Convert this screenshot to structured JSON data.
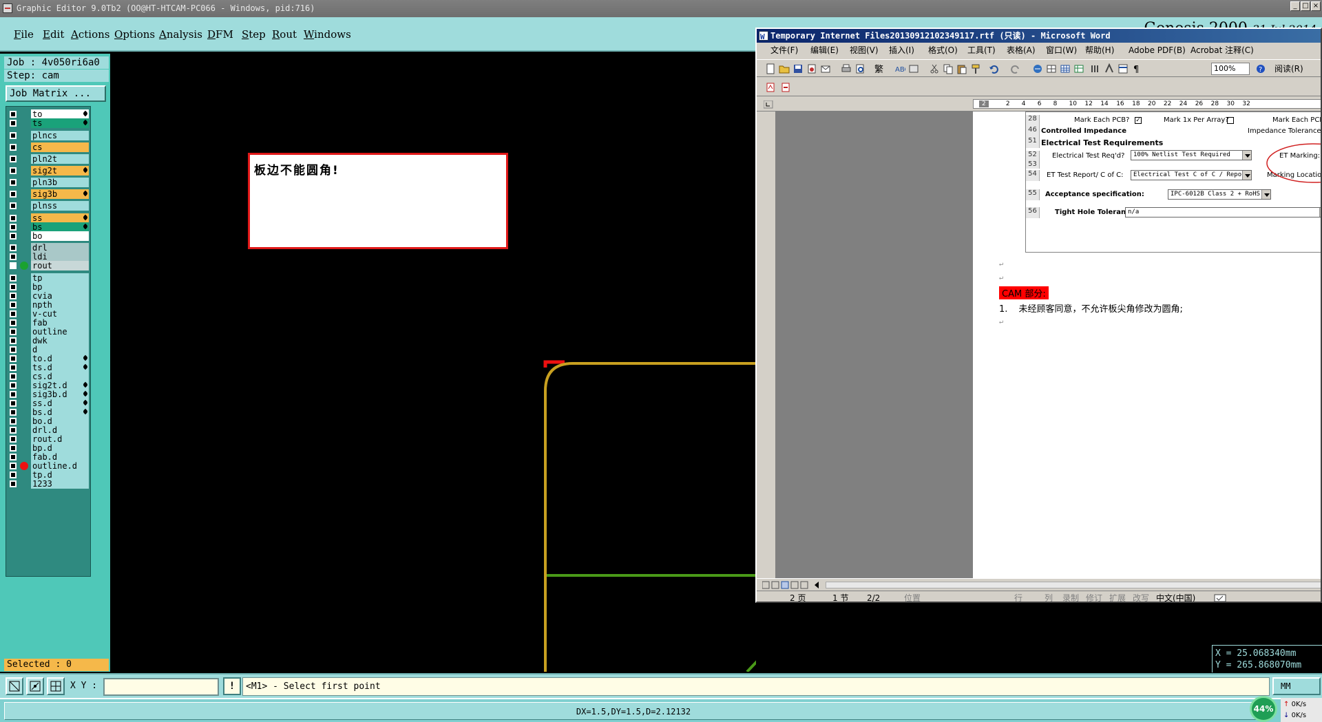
{
  "app": {
    "title": "Graphic Editor 9.0Tb2 (OO@HT-HTCAM-PC066 - Windows, pid:716)",
    "brand": "Genesis 2000",
    "date": "31 Jul 2014"
  },
  "menu": [
    "File",
    "Edit",
    "Actions",
    "Options",
    "Analysis",
    "DFM",
    "Step",
    "Rout",
    "Windows"
  ],
  "job": {
    "label": "Job : 4v050ri6a0",
    "step": "Step: cam",
    "matrix_button": "Job Matrix ..."
  },
  "layers": [
    {
      "name": "to",
      "color": "#ffffff",
      "pen": true,
      "dot": ""
    },
    {
      "name": "ts",
      "color": "#1aa27a",
      "pen": true,
      "dot": ""
    },
    {
      "name": "plncs",
      "color": "#9fdcdc",
      "pen": false,
      "dot": ""
    },
    {
      "name": "cs",
      "color": "#f5b84a",
      "pen": false,
      "dot": ""
    },
    {
      "name": "pln2t",
      "color": "#9fdcdc",
      "pen": false,
      "dot": ""
    },
    {
      "name": "sig2t",
      "color": "#f5b84a",
      "pen": true,
      "dot": ""
    },
    {
      "name": "pln3b",
      "color": "#9fdcdc",
      "pen": false,
      "dot": ""
    },
    {
      "name": "sig3b",
      "color": "#f5b84a",
      "pen": true,
      "dot": ""
    },
    {
      "name": "plnss",
      "color": "#9fdcdc",
      "pen": false,
      "dot": ""
    },
    {
      "name": "ss",
      "color": "#f5b84a",
      "pen": true,
      "dot": ""
    },
    {
      "name": "bs",
      "color": "#1aa27a",
      "pen": true,
      "dot": ""
    },
    {
      "name": "bo",
      "color": "#ffffff",
      "pen": false,
      "dot": ""
    },
    {
      "name": "drl",
      "color": "#a9c8c8",
      "pen": false,
      "dot": ""
    },
    {
      "name": "ldi",
      "color": "#a9c8c8",
      "pen": false,
      "dot": ""
    },
    {
      "name": "rout",
      "color": "#c8d8d8",
      "pen": false,
      "dot": "#1aa230"
    },
    {
      "name": "tp",
      "color": "#9fdcdc",
      "pen": false,
      "dot": ""
    },
    {
      "name": "bp",
      "color": "#9fdcdc",
      "pen": false,
      "dot": ""
    },
    {
      "name": "cvia",
      "color": "#9fdcdc",
      "pen": false,
      "dot": ""
    },
    {
      "name": "npth",
      "color": "#9fdcdc",
      "pen": false,
      "dot": ""
    },
    {
      "name": "v-cut",
      "color": "#9fdcdc",
      "pen": false,
      "dot": ""
    },
    {
      "name": "fab",
      "color": "#9fdcdc",
      "pen": false,
      "dot": ""
    },
    {
      "name": "outline",
      "color": "#9fdcdc",
      "pen": false,
      "dot": ""
    },
    {
      "name": "dwk",
      "color": "#9fdcdc",
      "pen": false,
      "dot": ""
    },
    {
      "name": "d",
      "color": "#9fdcdc",
      "pen": false,
      "dot": ""
    },
    {
      "name": "to.d",
      "color": "#9fdcdc",
      "pen": true,
      "dot": ""
    },
    {
      "name": "ts.d",
      "color": "#9fdcdc",
      "pen": true,
      "dot": ""
    },
    {
      "name": "cs.d",
      "color": "#9fdcdc",
      "pen": false,
      "dot": ""
    },
    {
      "name": "sig2t.d",
      "color": "#9fdcdc",
      "pen": true,
      "dot": ""
    },
    {
      "name": "sig3b.d",
      "color": "#9fdcdc",
      "pen": true,
      "dot": ""
    },
    {
      "name": "ss.d",
      "color": "#9fdcdc",
      "pen": true,
      "dot": ""
    },
    {
      "name": "bs.d",
      "color": "#9fdcdc",
      "pen": true,
      "dot": ""
    },
    {
      "name": "bo.d",
      "color": "#9fdcdc",
      "pen": false,
      "dot": ""
    },
    {
      "name": "drl.d",
      "color": "#9fdcdc",
      "pen": false,
      "dot": ""
    },
    {
      "name": "rout.d",
      "color": "#9fdcdc",
      "pen": false,
      "dot": ""
    },
    {
      "name": "bp.d",
      "color": "#9fdcdc",
      "pen": false,
      "dot": ""
    },
    {
      "name": "fab.d",
      "color": "#9fdcdc",
      "pen": false,
      "dot": ""
    },
    {
      "name": "outline.d",
      "color": "#9fdcdc",
      "pen": false,
      "dot": "#ee1111"
    },
    {
      "name": "tp.d",
      "color": "#9fdcdc",
      "pen": false,
      "dot": ""
    },
    {
      "name": "1233",
      "color": "#9fdcdc",
      "pen": false,
      "dot": ""
    }
  ],
  "selected": "Selected : 0",
  "note": "板边不能圆角!",
  "coords": {
    "x": "X = 25.068340mm",
    "y": "Y = 265.868070mm"
  },
  "cmd": {
    "xy_label": "X Y :",
    "xy_value": "",
    "prompt": "<M1> - Select first point",
    "unit": "MM"
  },
  "status": "DX=1.5,DY=1.5,D=2.12132",
  "net": {
    "percent": "44%",
    "up": "0K/s",
    "down": "0K/s"
  },
  "word": {
    "title": "Temporary Internet Files20130912102349117.rtf (只读) - Microsoft Word",
    "menu": [
      "文件(F)",
      "编辑(E)",
      "视图(V)",
      "插入(I)",
      "格式(O)",
      "工具(T)",
      "表格(A)",
      "窗口(W)",
      "帮助(H)",
      "Adobe PDF(B)",
      "Acrobat 注释(C)"
    ],
    "zoom": "100%",
    "read_label": "阅读(R)",
    "ruler": [
      "2",
      "2",
      "4",
      "6",
      "8",
      "10",
      "12",
      "14",
      "16",
      "18",
      "20",
      "22",
      "24",
      "26",
      "28",
      "30",
      "32"
    ],
    "form": {
      "r28": {
        "n": "28",
        "a": "Mark Each PCB?",
        "b": "Mark 1x Per Array?",
        "c": "Mark Each PCB"
      },
      "r46": {
        "n": "46",
        "a": "Controlled Impedance",
        "b": "Impedance Tolerance"
      },
      "r51": {
        "n": "51",
        "a": "Electrical Test Requirements"
      },
      "r52": {
        "n": "52",
        "a": "Electrical Test Req'd?",
        "v": "100% Netlist Test Required",
        "b": "ET Marking:"
      },
      "r53": {
        "n": "53"
      },
      "r54": {
        "n": "54",
        "a": "ET Test Report/ C of C:",
        "v": "Electrical Test C of C / Report",
        "b": "Marking Location:"
      },
      "r55": {
        "n": "55",
        "a": "Acceptance specification:",
        "v": "IPC-6012B Class 2 + RoHS"
      },
      "r56": {
        "n": "56",
        "a": "Tight Hole Tolerance:",
        "v": "n/a"
      }
    },
    "cam_label": "CAM 部分:",
    "item1_num": "1.",
    "item1": "未经顾客同意，不允许板尖角修改为圆角;",
    "status": {
      "page": "2 页",
      "section": "1 节",
      "pages": "2/2",
      "pos": "位置",
      "line": "行",
      "col": "列",
      "rec": "录制",
      "rev": "修订",
      "ext": "扩展",
      "ovr": "改写",
      "lang": "中文(中国)"
    }
  }
}
